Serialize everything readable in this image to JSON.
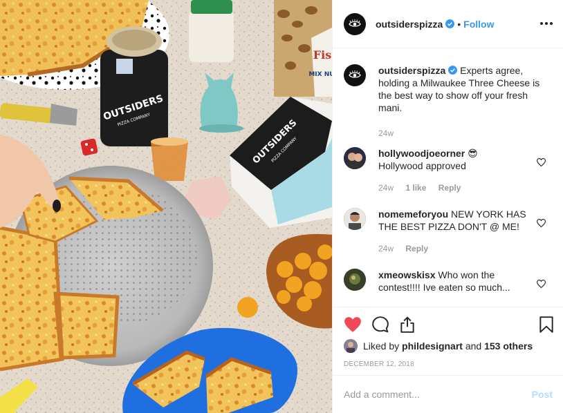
{
  "post": {
    "username": "outsiderspizza",
    "follow_label": "Follow",
    "dot": "•"
  },
  "caption": {
    "username": "outsiderspizza",
    "text": "Experts agree, holding a Milwaukee Three Cheese is the best way to show off your fresh mani.",
    "time": "24w"
  },
  "comments": [
    {
      "username": "hollywoodjoeorner",
      "text": "😎",
      "line2": "Hollywood approved",
      "time": "24w",
      "likes": "1 like",
      "reply": "Reply"
    },
    {
      "username": "nomemeforyou",
      "text": "NEW YORK HAS THE BEST PIZZA DON'T @ ME!",
      "time": "24w",
      "reply": "Reply"
    },
    {
      "username": "xmeowskisx",
      "text": "Who won the contest!!!! Ive eaten so much..."
    }
  ],
  "likes": {
    "prefix": "Liked by",
    "user": "phildesignart",
    "and": "and",
    "count": "153 others"
  },
  "date": "DECEMBER 12, 2018",
  "add_comment": {
    "placeholder": "Add a comment...",
    "post_label": "Post"
  },
  "photo_text": {
    "can_brand": "OUTSIDERS",
    "can_sub": "PIZZA COMPANY",
    "box_brand": "OUTSIDERS",
    "box_sub": "PIZZA COMPANY",
    "nut_label": "Fis",
    "nut_label2": "MIX NUT"
  },
  "colors": {
    "link_blue": "#3897f0",
    "like_red": "#ed4956",
    "post_disabled": "#b2dffc",
    "meta_gray": "#999999"
  },
  "icons": [
    "verified-badge-icon",
    "more-options-icon",
    "heart-icon",
    "comment-icon",
    "share-icon",
    "bookmark-icon"
  ]
}
